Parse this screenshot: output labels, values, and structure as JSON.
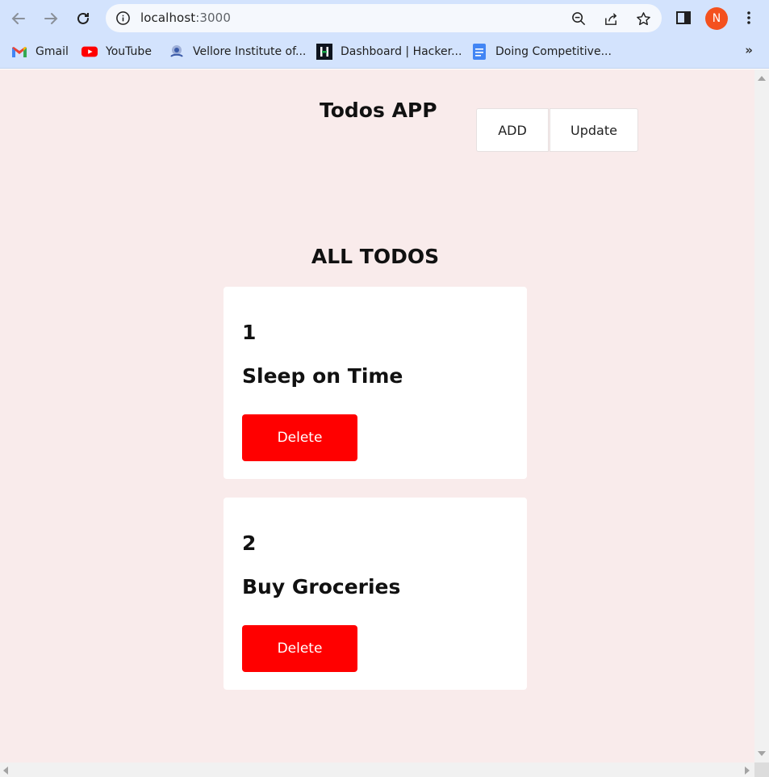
{
  "browser": {
    "url_host": "localhost",
    "url_port": ":3000",
    "profile_initial": "N",
    "bookmarks": [
      {
        "label": "Gmail",
        "icon": "gmail-icon"
      },
      {
        "label": "YouTube",
        "icon": "youtube-icon"
      },
      {
        "label": "Vellore Institute of...",
        "icon": "vit-icon"
      },
      {
        "label": "Dashboard | Hacker...",
        "icon": "hackerrank-icon"
      },
      {
        "label": "Doing Competitive...",
        "icon": "docs-icon"
      }
    ],
    "more_bookmarks": "»"
  },
  "app": {
    "title": "Todos APP",
    "add_label": "ADD",
    "update_label": "Update",
    "section_title": "ALL TODOS",
    "todos": [
      {
        "id": "1",
        "title": "Sleep on Time",
        "delete_label": "Delete"
      },
      {
        "id": "2",
        "title": "Buy Groceries",
        "delete_label": "Delete"
      }
    ]
  },
  "colors": {
    "page_bg": "#f9ebeb",
    "delete_bg": "#ff0000",
    "chrome_bg": "#d3e3fd",
    "avatar_bg": "#f4511e"
  }
}
